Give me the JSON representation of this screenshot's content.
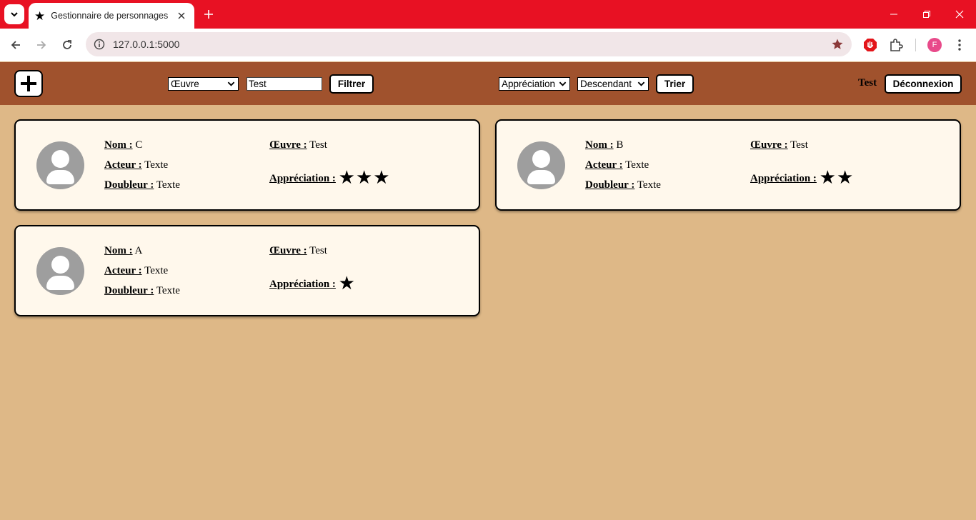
{
  "browser": {
    "tab_title": "Gestionnaire de personnages",
    "url": "127.0.0.1:5000",
    "profile_initial": "F"
  },
  "header": {
    "filter_field": "Œuvre",
    "filter_value": "Test",
    "filter_button": "Filtrer",
    "sort_field": "Appréciation",
    "sort_order": "Descendant",
    "sort_button": "Trier",
    "username": "Test",
    "logout_button": "Déconnexion"
  },
  "labels": {
    "name": "Nom :",
    "actor": "Acteur :",
    "voice": "Doubleur :",
    "work": "Œuvre :",
    "rating": "Appréciation :"
  },
  "cards": [
    {
      "name": "C",
      "actor": "Texte",
      "voice": "Texte",
      "work": "Test",
      "rating": 3,
      "rating_stars": "★★★"
    },
    {
      "name": "B",
      "actor": "Texte",
      "voice": "Texte",
      "work": "Test",
      "rating": 2,
      "rating_stars": "★★"
    },
    {
      "name": "A",
      "actor": "Texte",
      "voice": "Texte",
      "work": "Test",
      "rating": 1,
      "rating_stars": "★"
    }
  ],
  "colors": {
    "titlebar": "#e81123",
    "header": "#a0522d",
    "page_background": "#deb887",
    "card_background": "#fff8ec"
  }
}
